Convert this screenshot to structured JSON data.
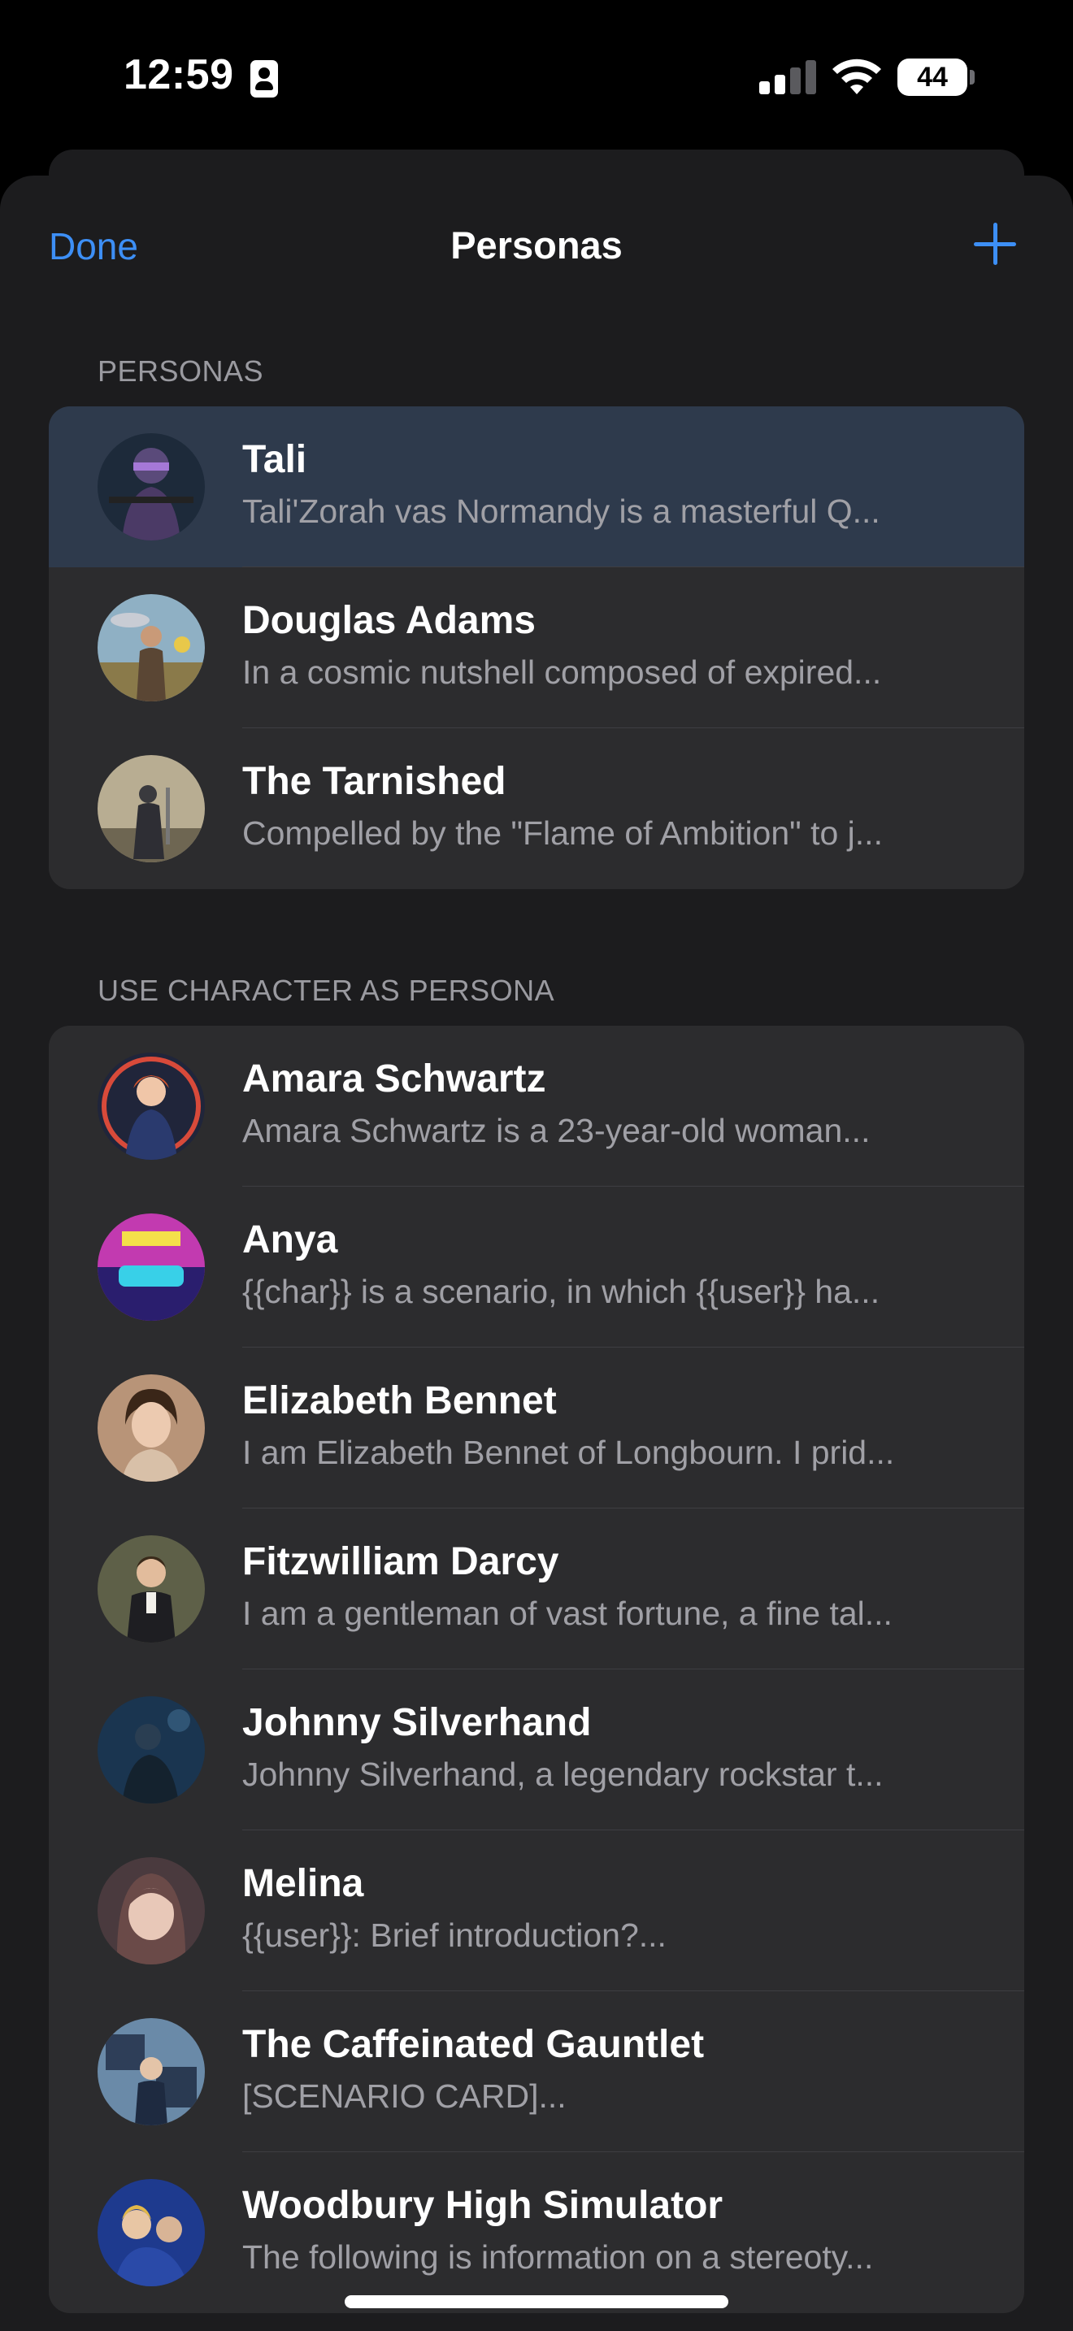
{
  "status_bar": {
    "time": "12:59",
    "battery": "44",
    "contact_icon": "person-badge-icon",
    "signal_icon": "cellular-signal-icon",
    "wifi_icon": "wifi-icon"
  },
  "nav": {
    "done_label": "Done",
    "title": "Personas",
    "add_icon": "plus-icon",
    "accent_color": "#3d8ff6"
  },
  "personas_section": {
    "header": "PERSONAS",
    "items": [
      {
        "name": "Tali",
        "description": "Tali'Zorah vas Normandy is a masterful Q...",
        "selected": true
      },
      {
        "name": "Douglas Adams",
        "description": "In a cosmic nutshell composed of expired..."
      },
      {
        "name": "The Tarnished",
        "description": "Compelled by the \"Flame of Ambition\" to j..."
      }
    ]
  },
  "characters_section": {
    "header": "USE CHARACTER AS PERSONA",
    "items": [
      {
        "name": "Amara Schwartz",
        "description": "Amara Schwartz is a 23-year-old woman..."
      },
      {
        "name": "Anya",
        "description": "{{char}} is a scenario, in which {{user}} ha..."
      },
      {
        "name": "Elizabeth Bennet",
        "description": "I am Elizabeth Bennet of Longbourn. I prid..."
      },
      {
        "name": "Fitzwilliam Darcy",
        "description": "I am a gentleman of vast fortune, a fine tal..."
      },
      {
        "name": "Johnny Silverhand",
        "description": "Johnny Silverhand, a legendary rockstar t..."
      },
      {
        "name": "Melina",
        "description": "{{user}}: Brief introduction?..."
      },
      {
        "name": "The Caffeinated Gauntlet",
        "description": "[SCENARIO CARD]..."
      },
      {
        "name": "Woodbury High Simulator",
        "description": "The following is information on a stereoty..."
      }
    ]
  }
}
